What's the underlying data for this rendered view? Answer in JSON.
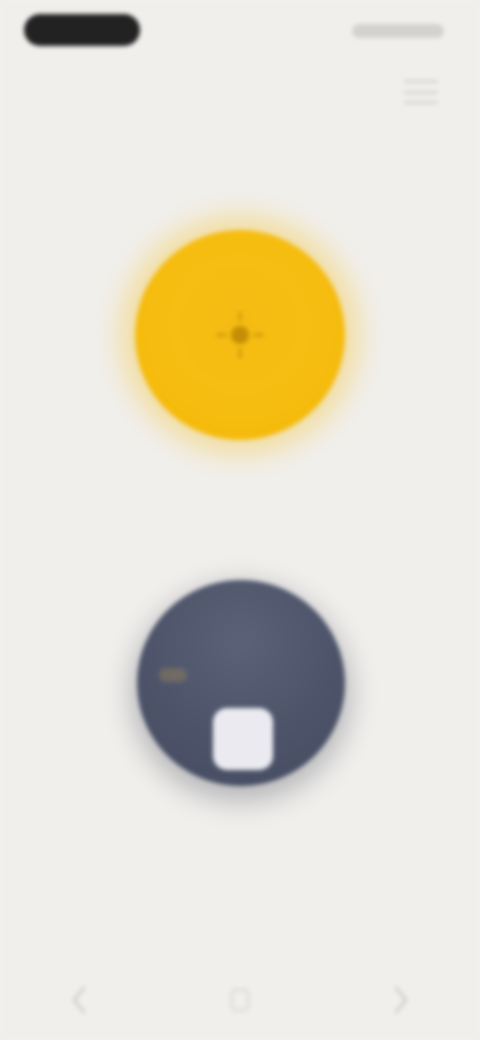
{
  "status_bar": {
    "pill_icon": "status-pill",
    "right_icons": "status-indicators"
  },
  "header": {
    "menu_icon": "menu-icon"
  },
  "main": {
    "primary_button": {
      "icon": "sun-icon",
      "color": "#f4bc13"
    },
    "secondary_button": {
      "icon": "moon-card-icon",
      "color": "#4e556b"
    }
  },
  "bottom_nav": {
    "items": [
      {
        "icon": "back-icon"
      },
      {
        "icon": "home-icon"
      },
      {
        "icon": "recents-icon"
      }
    ]
  }
}
